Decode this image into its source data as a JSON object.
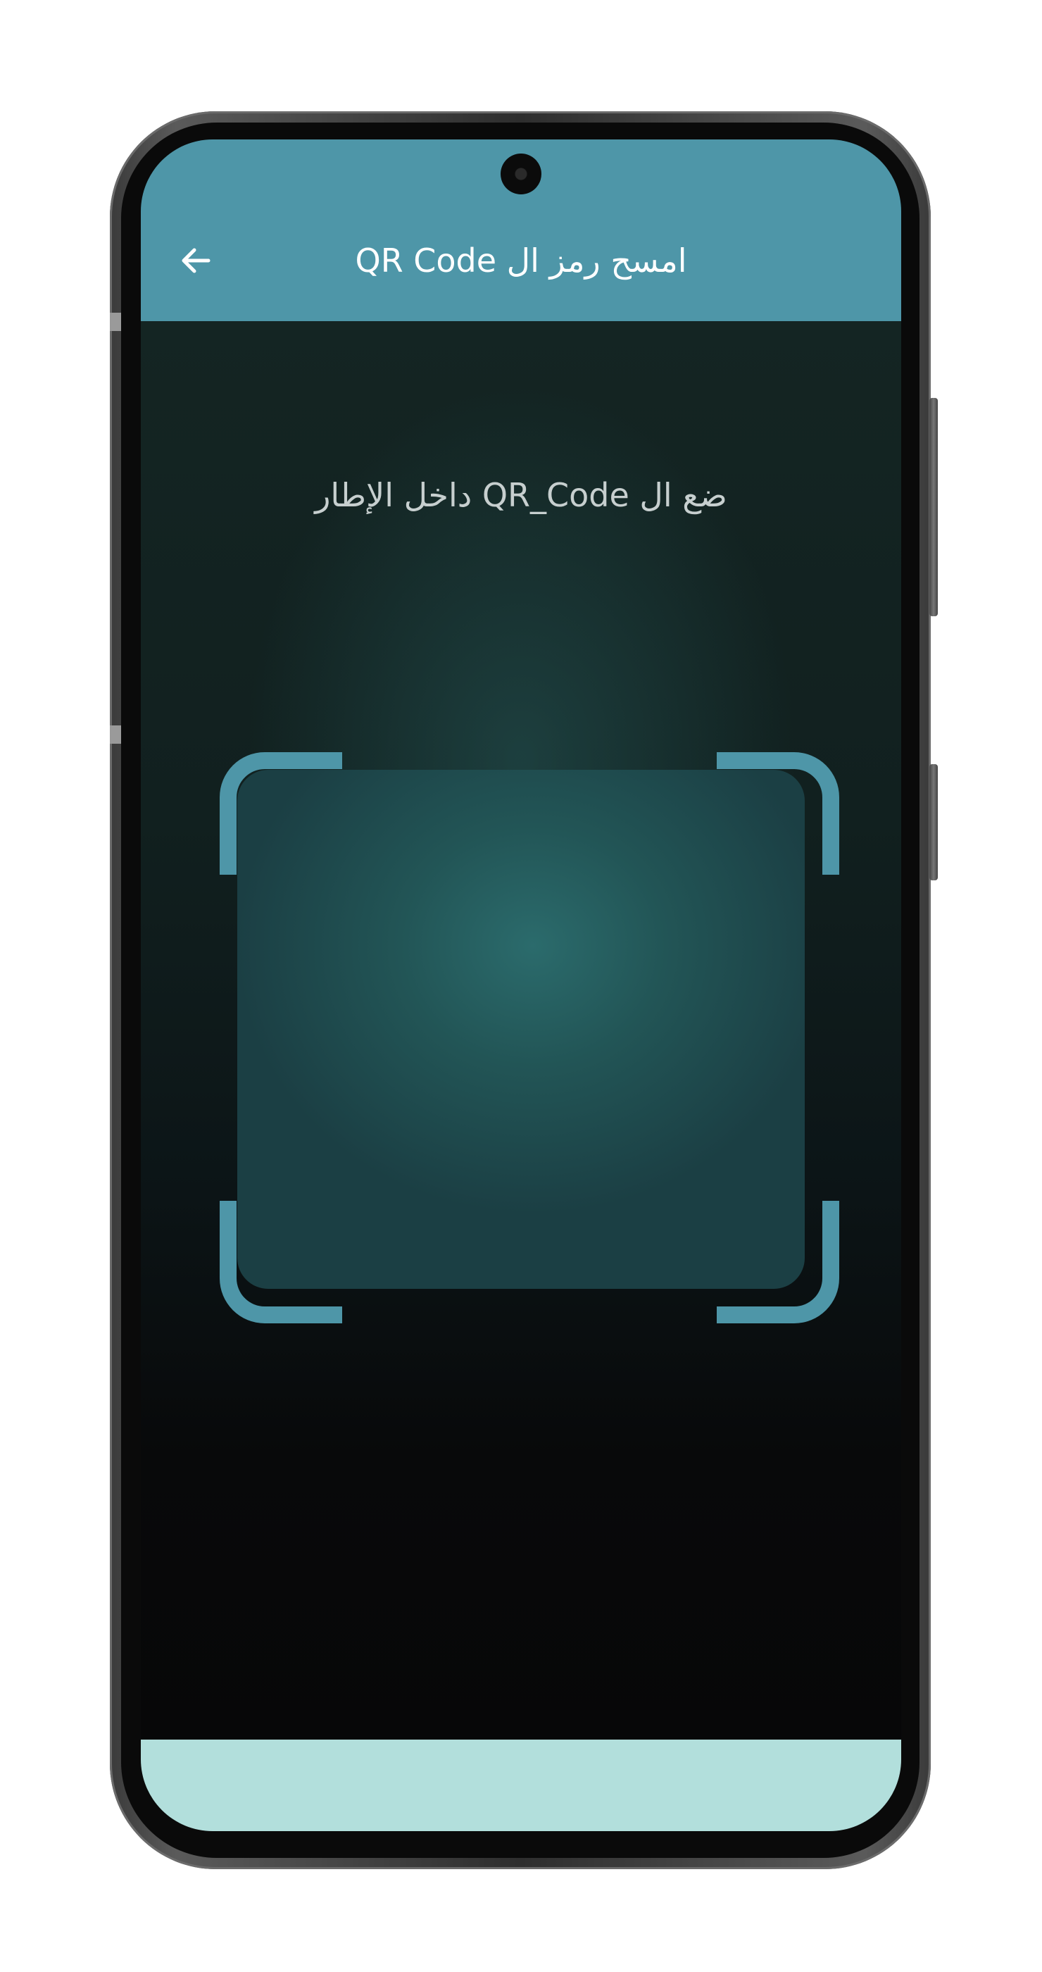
{
  "app_bar": {
    "title": "امسح رمز ال QR Code",
    "back_icon": "arrow-left-icon",
    "color": "#4e96a8"
  },
  "scanner": {
    "instruction": "ضع ال QR_Code داخل الإطار",
    "frame_color": "#4e96a8"
  },
  "bottom_bar": {
    "color": "#b2dfdc"
  }
}
